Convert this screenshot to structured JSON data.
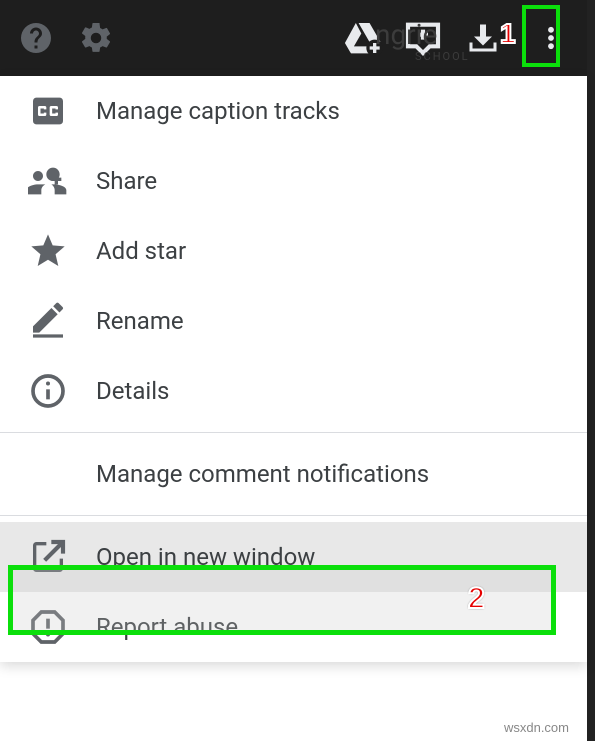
{
  "toolbar": {
    "help_icon": "help-icon",
    "settings_icon": "gear-icon",
    "drive_icon": "drive-add-icon",
    "comment_icon": "comment-add-icon",
    "download_icon": "download-icon",
    "more_icon": "more-vert-icon",
    "bg_text": "ngrie",
    "bg_sub": "SCHOOL"
  },
  "markers": {
    "one": "1",
    "two": "2"
  },
  "menu": {
    "caption_tracks": "Manage caption tracks",
    "share": "Share",
    "add_star": "Add star",
    "rename": "Rename",
    "details": "Details",
    "notifications": "Manage comment notifications",
    "open_new_window": "Open in new window",
    "report_abuse": "Report abuse"
  },
  "watermark": "wsxdn.com"
}
